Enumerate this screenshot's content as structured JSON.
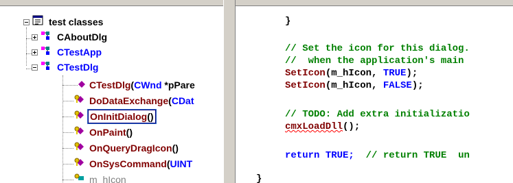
{
  "tree": {
    "root": "test classes",
    "classes": [
      "CAboutDlg",
      "CTestApp",
      "CTestDlg"
    ],
    "members": [
      {
        "name": "CTestDlg",
        "open": "(",
        "type": "CWnd",
        "rest": " *pPare"
      },
      {
        "name": "DoDataExchange",
        "open": "(",
        "type": "CDat",
        "rest": ""
      },
      {
        "name": "OnInitDialog",
        "open": "()",
        "type": "",
        "rest": ""
      },
      {
        "name": "OnPaint",
        "open": "()",
        "type": "",
        "rest": ""
      },
      {
        "name": "OnQueryDragIcon",
        "open": "()",
        "type": "",
        "rest": ""
      },
      {
        "name": "OnSysCommand",
        "open": "(",
        "type": "UINT",
        "rest": ""
      },
      {
        "name": "m_hIcon",
        "open": "",
        "type": "",
        "rest": ""
      }
    ]
  },
  "code": {
    "close_brace": "}",
    "comment1": "// Set the icon for this dialog.",
    "comment2": "//  when the application's main",
    "set_icon_fn": "SetIcon",
    "set_icon_arg1": "(m_hIcon, ",
    "set_icon_true": "TRUE",
    "set_icon_false": "FALSE",
    "set_icon_end": ");",
    "todo": "// TODO: Add extra initializatio",
    "load_dll": "cmxLoadDll",
    "load_dll_end": "();",
    "return_kw": "return",
    "return_val": " TRUE;",
    "return_comment": "  // return TRUE  un",
    "final_brace": "}"
  },
  "colors": {
    "keyword": "#0000ff",
    "comment": "#008000",
    "function": "#800000"
  }
}
